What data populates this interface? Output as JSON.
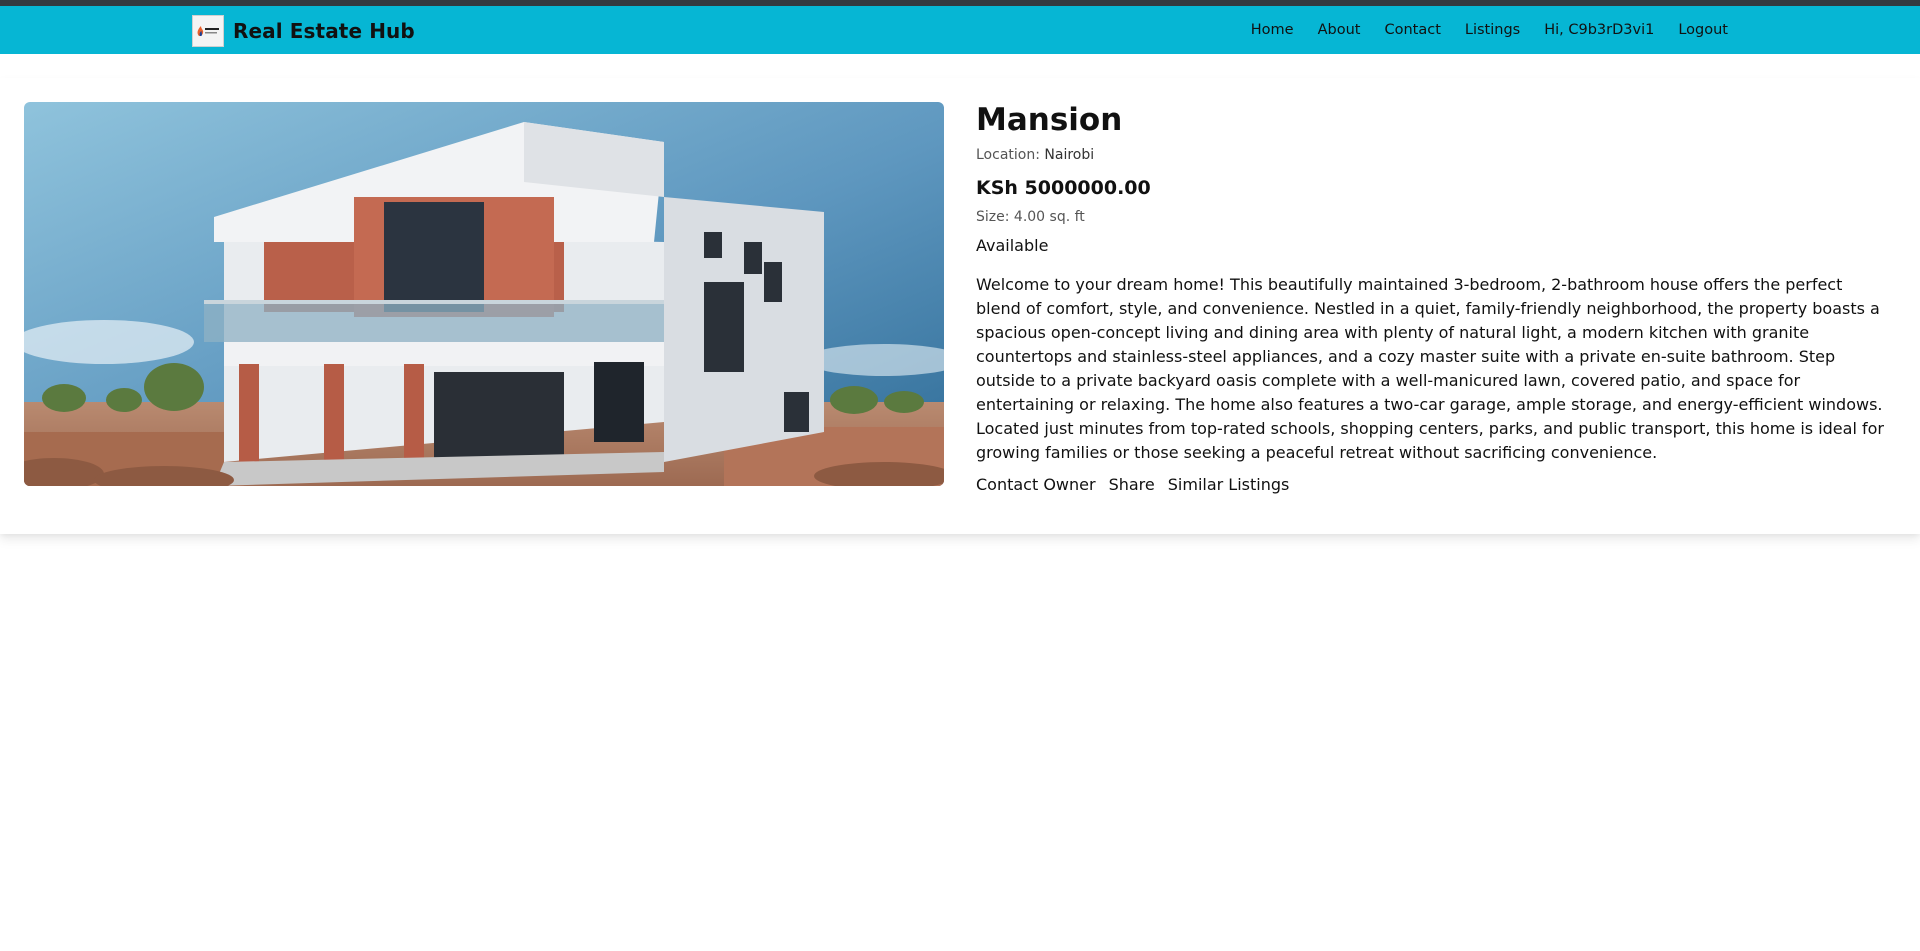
{
  "header": {
    "brand_name": "Real Estate Hub",
    "logo_icon": "company-logo",
    "nav": [
      {
        "label": "Home"
      },
      {
        "label": "About"
      },
      {
        "label": "Contact"
      },
      {
        "label": "Listings"
      },
      {
        "label": "Hi, C9b3rD3vi1"
      },
      {
        "label": "Logout"
      }
    ],
    "accent_color": "#06b6d4"
  },
  "listing": {
    "image_alt": "Modern two-storey house",
    "title": "Mansion",
    "location_label": "Location:",
    "location": "Nairobi",
    "price": "KSh 5000000.00",
    "size": "Size: 4.00 sq. ft",
    "status": "Available",
    "description": "Welcome to your dream home! This beautifully maintained 3-bedroom, 2-bathroom house offers the perfect blend of comfort, style, and convenience. Nestled in a quiet, family-friendly neighborhood, the property boasts a spacious open-concept living and dining area with plenty of natural light, a modern kitchen with granite countertops and stainless-steel appliances, and a cozy master suite with a private en-suite bathroom. Step outside to a private backyard oasis complete with a well-manicured lawn, covered patio, and space for entertaining or relaxing. The home also features a two-car garage, ample storage, and energy-efficient windows. Located just minutes from top-rated schools, shopping centers, parks, and public transport, this home is ideal for growing families or those seeking a peaceful retreat without sacrificing convenience.",
    "actions": [
      {
        "label": "Contact Owner"
      },
      {
        "label": "Share"
      },
      {
        "label": "Similar Listings"
      }
    ]
  }
}
